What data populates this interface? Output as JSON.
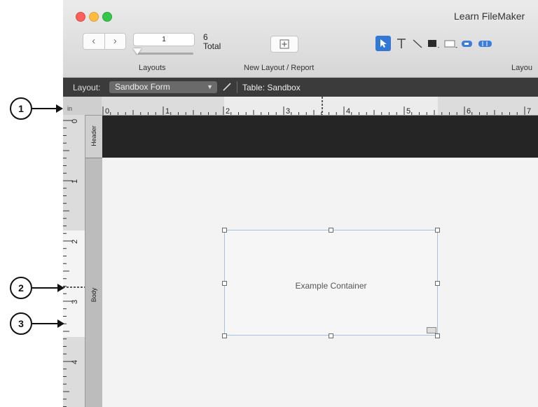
{
  "window": {
    "title": "Learn FileMaker"
  },
  "toolbar": {
    "record_value": "1",
    "count": "6",
    "total_label": "Total",
    "layouts_label": "Layouts",
    "new_layout_label": "New Layout / Report",
    "layout_tools_label": "Layou"
  },
  "layout_bar": {
    "layout_label": "Layout:",
    "layout_name": "Sandbox Form",
    "table_label": "Table: Sandbox"
  },
  "ruler": {
    "unit": "in",
    "h_numbers": [
      "0",
      "1",
      "2",
      "3",
      "4",
      "5",
      "6",
      "7"
    ],
    "v_numbers": [
      "0",
      "1",
      "2",
      "3",
      "4"
    ]
  },
  "parts": {
    "header": "Header",
    "body": "Body"
  },
  "container": {
    "label": "Example Container"
  },
  "callouts": [
    "1",
    "2",
    "3"
  ],
  "colors": {
    "accent": "#3478d7",
    "header_band": "#252525",
    "selection": "#a7c1e3"
  }
}
